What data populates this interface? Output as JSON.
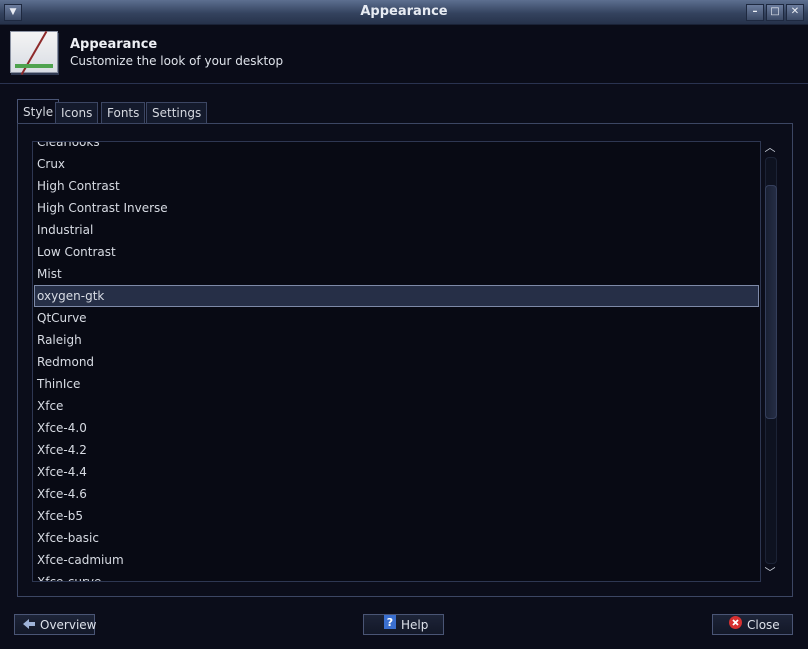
{
  "window": {
    "title": "Appearance"
  },
  "header": {
    "title": "Appearance",
    "subtitle": "Customize the look of your desktop"
  },
  "tabs": [
    {
      "label": "Style",
      "active": true
    },
    {
      "label": "Icons",
      "active": false
    },
    {
      "label": "Fonts",
      "active": false
    },
    {
      "label": "Settings",
      "active": false
    }
  ],
  "theme_list": {
    "items": [
      "Clearlooks",
      "Crux",
      "High Contrast",
      "High Contrast Inverse",
      "Industrial",
      "Low Contrast",
      "Mist",
      "oxygen-gtk",
      "QtCurve",
      "Raleigh",
      "Redmond",
      "ThinIce",
      "Xfce",
      "Xfce-4.0",
      "Xfce-4.2",
      "Xfce-4.4",
      "Xfce-4.6",
      "Xfce-b5",
      "Xfce-basic",
      "Xfce-cadmium",
      "Xfce-curve"
    ],
    "selected": "oxygen-gtk"
  },
  "buttons": {
    "overview": "Overview",
    "help": "Help",
    "close": "Close"
  },
  "colors": {
    "background": "#0b0d1a",
    "selection": "#262f47",
    "close_icon": "#d63030",
    "help_icon": "#3a6fd0"
  }
}
